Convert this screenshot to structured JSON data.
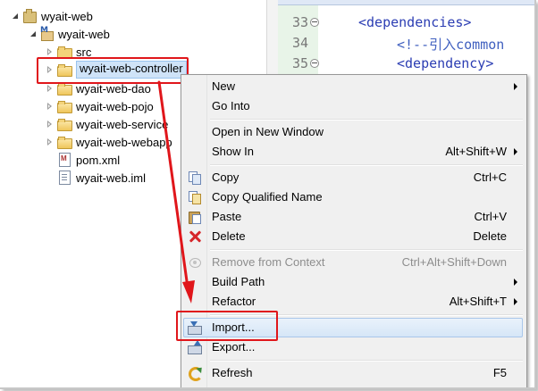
{
  "tree": {
    "items": [
      {
        "label": "wyait-web"
      },
      {
        "label": "wyait-web"
      },
      {
        "label": "src"
      },
      {
        "label": "wyait-web-controller"
      },
      {
        "label": "wyait-web-dao"
      },
      {
        "label": "wyait-web-pojo"
      },
      {
        "label": "wyait-web-service"
      },
      {
        "label": "wyait-web-webapp"
      },
      {
        "label": "pom.xml"
      },
      {
        "label": "wyait-web.iml"
      }
    ]
  },
  "editor": {
    "lines": [
      {
        "num": "33",
        "text": "<dependencies>"
      },
      {
        "num": "34",
        "text": "<!--引入common"
      },
      {
        "num": "35",
        "text": "<dependency>"
      }
    ]
  },
  "menu": {
    "items": [
      {
        "label": "New",
        "shortcut": ""
      },
      {
        "label": "Go Into",
        "shortcut": ""
      },
      {
        "label": "Open in New Window",
        "shortcut": ""
      },
      {
        "label": "Show In",
        "shortcut": "Alt+Shift+W"
      },
      {
        "label": "Copy",
        "shortcut": "Ctrl+C"
      },
      {
        "label": "Copy Qualified Name",
        "shortcut": ""
      },
      {
        "label": "Paste",
        "shortcut": "Ctrl+V"
      },
      {
        "label": "Delete",
        "shortcut": "Delete"
      },
      {
        "label": "Remove from Context",
        "shortcut": "Ctrl+Alt+Shift+Down"
      },
      {
        "label": "Build Path",
        "shortcut": ""
      },
      {
        "label": "Refactor",
        "shortcut": "Alt+Shift+T"
      },
      {
        "label": "Import...",
        "shortcut": ""
      },
      {
        "label": "Export...",
        "shortcut": ""
      },
      {
        "label": "Refresh",
        "shortcut": "F5"
      }
    ]
  },
  "colors": {
    "annotation_red": "#e0161b",
    "selection_blue": "#cfe3f8",
    "editor_gutter_green": "#e8f4e8",
    "xml_tag_blue": "#2b3db3"
  }
}
